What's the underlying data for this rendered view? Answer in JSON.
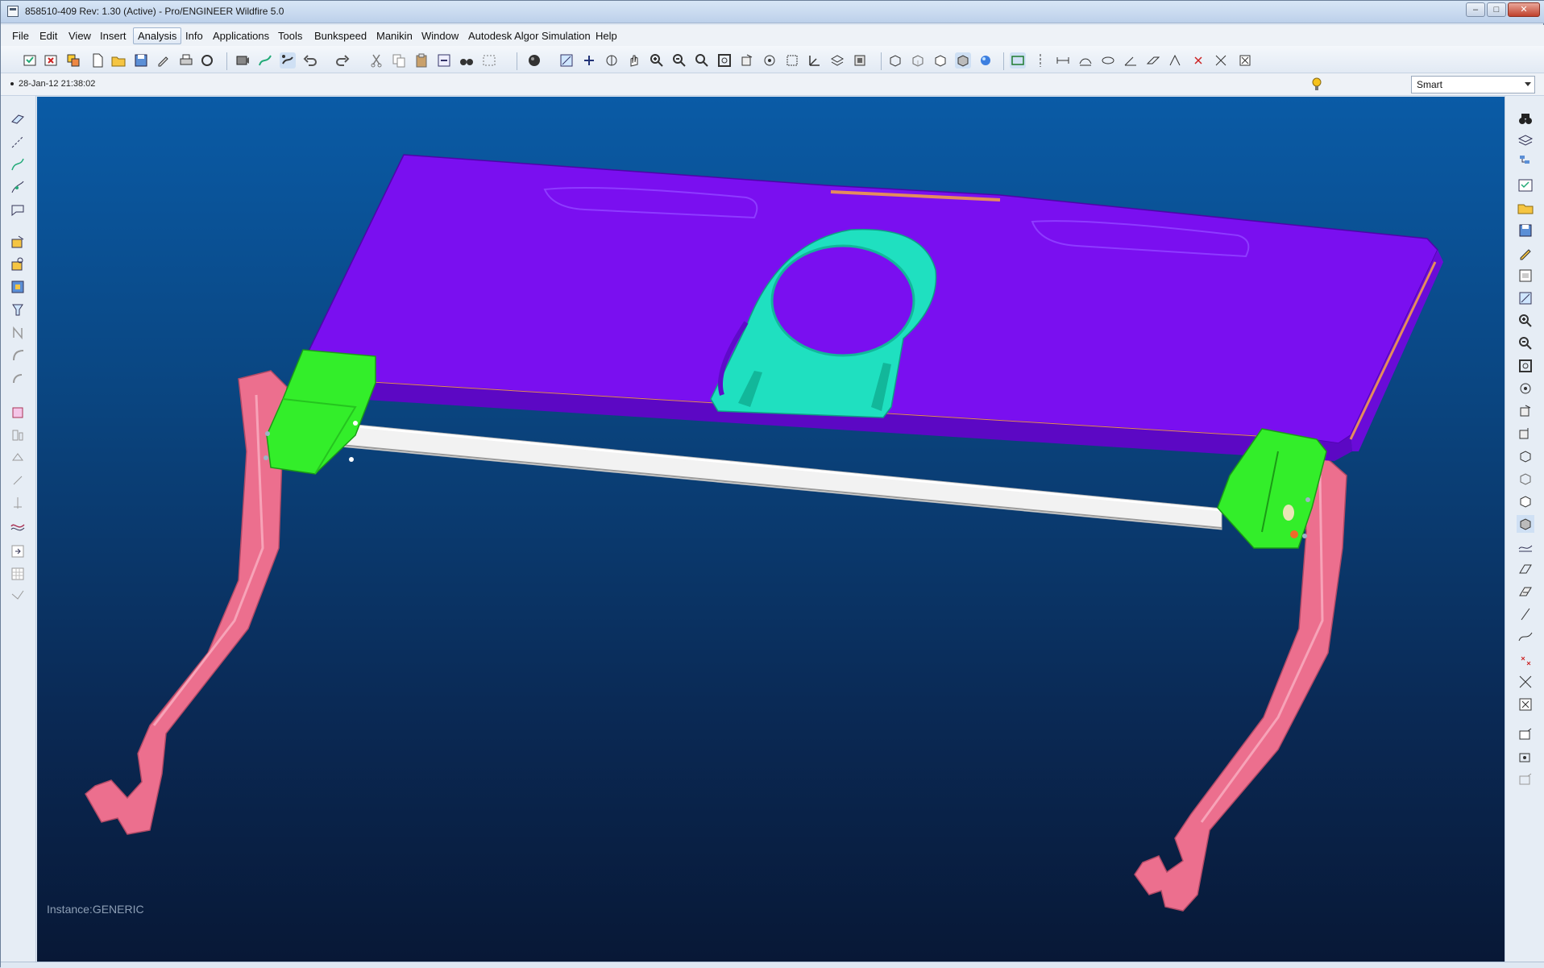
{
  "window": {
    "title": "858510-409 Rev: 1.30 (Active) - Pro/ENGINEER Wildfire 5.0",
    "buttons": {
      "minimize": "–",
      "maximize": "□",
      "close": "✕"
    }
  },
  "menu": {
    "items": [
      "File",
      "Edit",
      "View",
      "Insert",
      "Analysis",
      "Info",
      "Applications",
      "Tools",
      "Bunkspeed",
      "Manikin",
      "Window",
      "Autodesk Algor Simulation",
      "Help"
    ],
    "active": "Analysis"
  },
  "status": {
    "message": "28-Jan-12 21:38:02",
    "selection_filter": "Smart"
  },
  "viewport": {
    "instance_label": "Instance:GENERIC",
    "background_top": "#0a5ba6",
    "background_bottom": "#081836"
  },
  "model_colors": {
    "panel": "#7a0ff0",
    "ring": "#1fe0c0",
    "brackets": "#33ee2a",
    "legs": "#ec6f8e",
    "rod": "#f2f2f2"
  }
}
